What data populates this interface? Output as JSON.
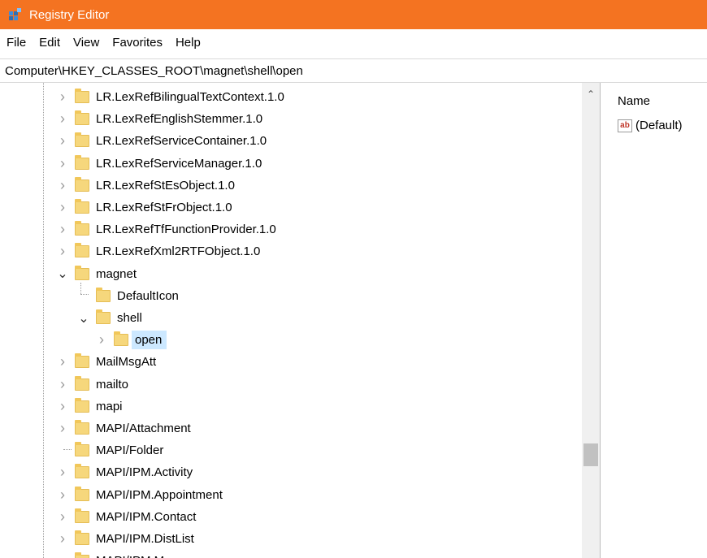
{
  "window": {
    "title": "Registry Editor",
    "accent": "#f47321"
  },
  "menu": [
    "File",
    "Edit",
    "View",
    "Favorites",
    "Help"
  ],
  "address": "Computer\\HKEY_CLASSES_ROOT\\magnet\\shell\\open",
  "tree": [
    {
      "label": "LR.LexRefBilingualTextContext.1.0",
      "level": 0,
      "expander": "collapsed"
    },
    {
      "label": "LR.LexRefEnglishStemmer.1.0",
      "level": 0,
      "expander": "collapsed"
    },
    {
      "label": "LR.LexRefServiceContainer.1.0",
      "level": 0,
      "expander": "collapsed"
    },
    {
      "label": "LR.LexRefServiceManager.1.0",
      "level": 0,
      "expander": "collapsed"
    },
    {
      "label": "LR.LexRefStEsObject.1.0",
      "level": 0,
      "expander": "collapsed"
    },
    {
      "label": "LR.LexRefStFrObject.1.0",
      "level": 0,
      "expander": "collapsed"
    },
    {
      "label": "LR.LexRefTfFunctionProvider.1.0",
      "level": 0,
      "expander": "collapsed"
    },
    {
      "label": "LR.LexRefXml2RTFObject.1.0",
      "level": 0,
      "expander": "collapsed"
    },
    {
      "label": "magnet",
      "level": 0,
      "expander": "expanded"
    },
    {
      "label": "DefaultIcon",
      "level": 1,
      "expander": "none"
    },
    {
      "label": "shell",
      "level": 1,
      "expander": "expanded"
    },
    {
      "label": "open",
      "level": 2,
      "expander": "collapsed",
      "selected": true
    },
    {
      "label": "MailMsgAtt",
      "level": 0,
      "expander": "collapsed"
    },
    {
      "label": "mailto",
      "level": 0,
      "expander": "collapsed"
    },
    {
      "label": "mapi",
      "level": 0,
      "expander": "collapsed"
    },
    {
      "label": "MAPI/Attachment",
      "level": 0,
      "expander": "collapsed"
    },
    {
      "label": "MAPI/Folder",
      "level": 0,
      "expander": "none"
    },
    {
      "label": "MAPI/IPM.Activity",
      "level": 0,
      "expander": "collapsed"
    },
    {
      "label": "MAPI/IPM.Appointment",
      "level": 0,
      "expander": "collapsed"
    },
    {
      "label": "MAPI/IPM.Contact",
      "level": 0,
      "expander": "collapsed"
    },
    {
      "label": "MAPI/IPM.DistList",
      "level": 0,
      "expander": "collapsed"
    },
    {
      "label": "MAPI/IPM.Message",
      "level": 0,
      "expander": "collapsed"
    }
  ],
  "values_pane": {
    "column_name": "Name",
    "values": [
      {
        "icon": "string-value-icon",
        "icon_text": "ab",
        "name": "(Default)"
      }
    ]
  },
  "colors": {
    "selection": "#cce8ff",
    "folder": "#f6d77c"
  }
}
